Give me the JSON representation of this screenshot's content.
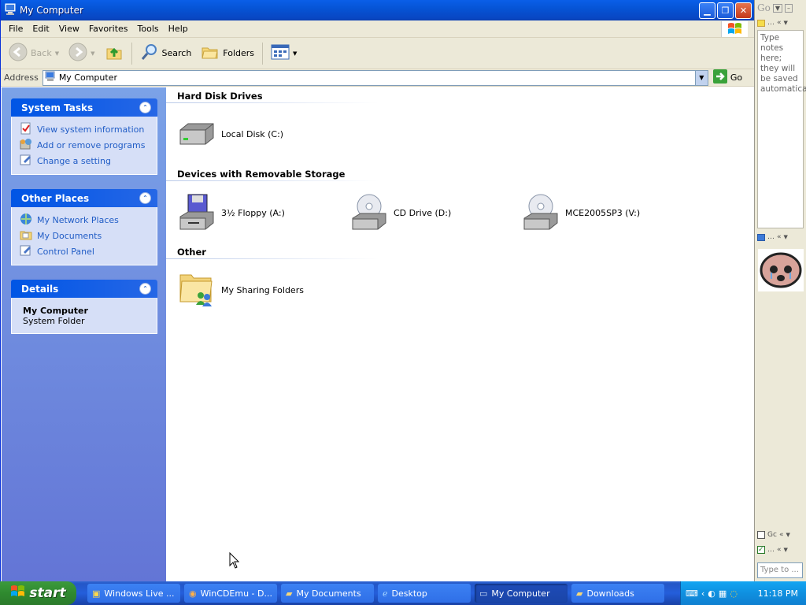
{
  "window": {
    "title": "My Computer"
  },
  "menu": [
    "File",
    "Edit",
    "View",
    "Favorites",
    "Tools",
    "Help"
  ],
  "toolbar": {
    "back": "Back",
    "search": "Search",
    "folders": "Folders"
  },
  "address": {
    "label": "Address",
    "value": "My Computer",
    "go": "Go"
  },
  "left_pane": {
    "system_tasks": {
      "title": "System Tasks",
      "items": [
        "View system information",
        "Add or remove programs",
        "Change a setting"
      ]
    },
    "other_places": {
      "title": "Other Places",
      "items": [
        "My Network Places",
        "My Documents",
        "Control Panel"
      ]
    },
    "details": {
      "title": "Details",
      "name": "My Computer",
      "type": "System Folder"
    }
  },
  "content": {
    "groups": [
      {
        "title": "Hard Disk Drives",
        "items": [
          "Local Disk (C:)"
        ]
      },
      {
        "title": "Devices with Removable Storage",
        "items": [
          "3½ Floppy (A:)",
          "CD Drive (D:)",
          "MCE2005SP3 (V:)"
        ]
      },
      {
        "title": "Other",
        "items": [
          "My Sharing Folders"
        ]
      }
    ]
  },
  "sidebar": {
    "notes_text": "Type notes here; they will be saved automatically.",
    "search_placeholder": "Type to ...",
    "gadget_label": "Gc"
  },
  "taskbar": {
    "start": "start",
    "tasks": [
      "Windows Live ...",
      "WinCDEmu - D...",
      "My Documents",
      "Desktop",
      "My Computer",
      "Downloads"
    ],
    "active_task": "My Computer",
    "clock": "11:18 PM"
  },
  "colors": {
    "title_bar": "#0a5fe8",
    "task_pane_link": "#215dc6",
    "taskbar": "#245edb",
    "start_button": "#3c9a3c"
  }
}
